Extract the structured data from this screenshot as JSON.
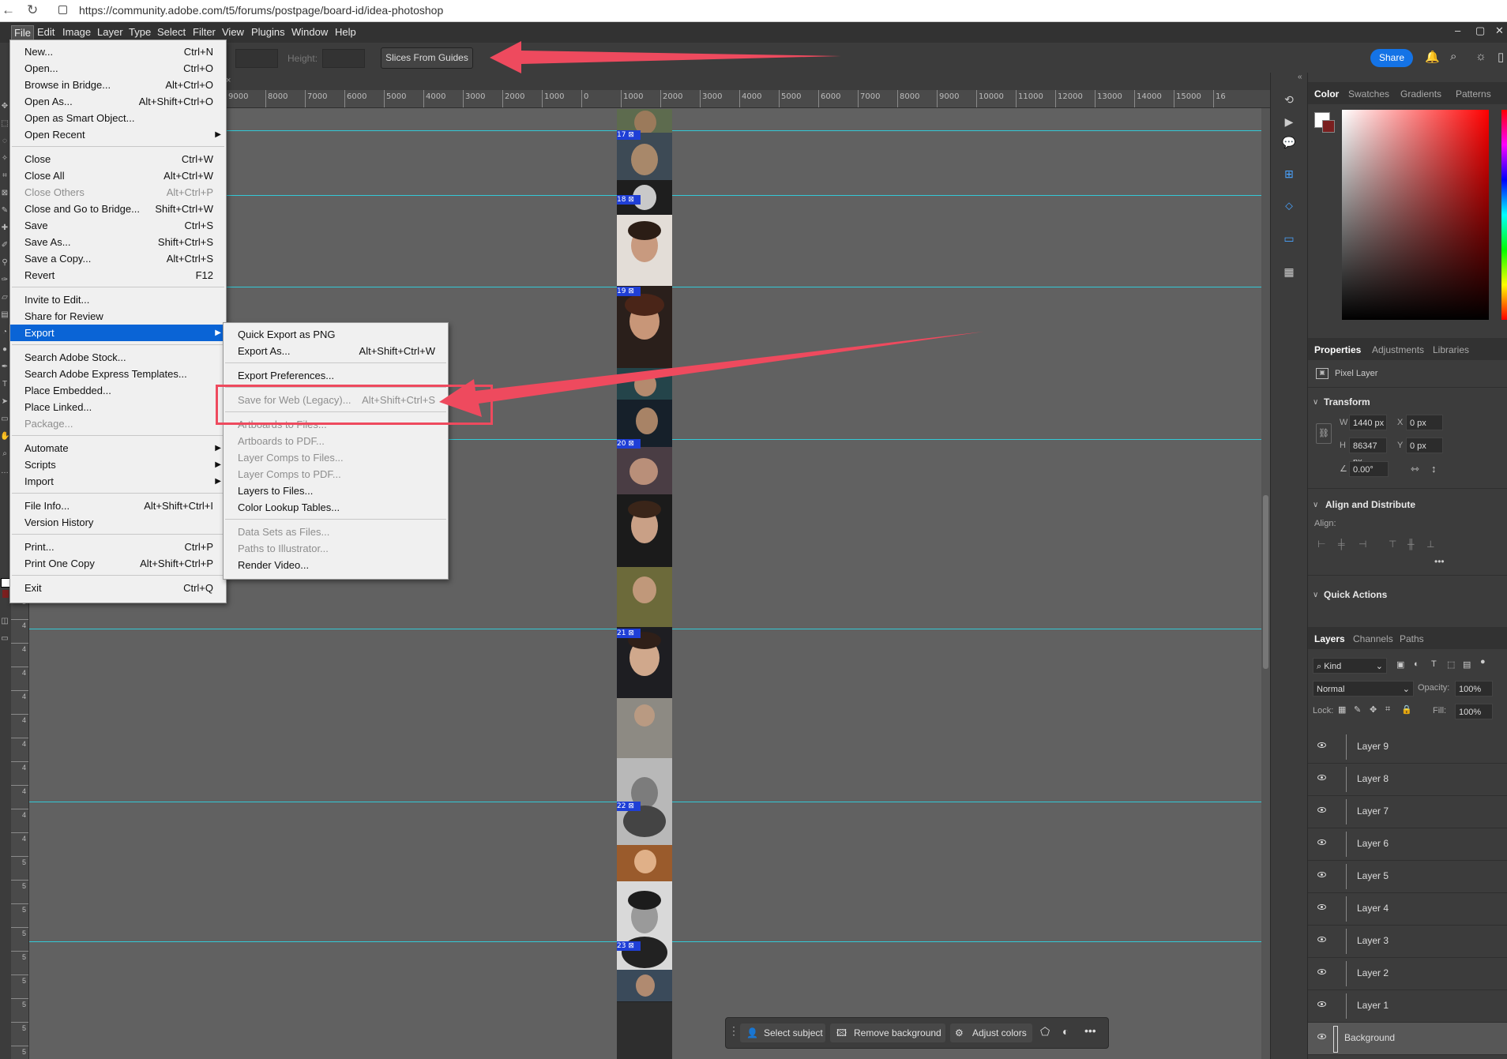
{
  "browser": {
    "url": "https://community.adobe.com/t5/forums/postpage/board-id/idea-photoshop"
  },
  "menubar": {
    "items": [
      "File",
      "Edit",
      "Image",
      "Layer",
      "Type",
      "Select",
      "Filter",
      "View",
      "Plugins",
      "Window",
      "Help"
    ]
  },
  "options": {
    "height_label": "Height:",
    "slices_button": "Slices From Guides",
    "share_button": "Share"
  },
  "ruler": {
    "h_labels": [
      "9000",
      "8000",
      "7000",
      "6000",
      "5000",
      "4000",
      "3000",
      "2000",
      "1000",
      "0",
      "1000",
      "2000",
      "3000",
      "4000",
      "5000",
      "6000",
      "7000",
      "8000",
      "9000",
      "10000",
      "11000",
      "12000",
      "13000",
      "14000",
      "15000",
      "16"
    ],
    "v_labels": [
      "3",
      "4",
      "4",
      "4",
      "4",
      "4",
      "4",
      "4",
      "4",
      "4",
      "4",
      "5",
      "5",
      "5",
      "5",
      "5",
      "5",
      "5",
      "5",
      "5",
      "5"
    ]
  },
  "slices": [
    "17",
    "18",
    "19",
    "20",
    "21",
    "22",
    "23"
  ],
  "context_bar": {
    "select_subject": "Select subject",
    "remove_background": "Remove background",
    "adjust_colors": "Adjust colors"
  },
  "color_panel": {
    "tabs": [
      "Color",
      "Swatches",
      "Gradients",
      "Patterns"
    ],
    "accent": "#ff0000"
  },
  "properties_panel": {
    "tabs": [
      "Properties",
      "Adjustments",
      "Libraries"
    ],
    "kind": "Pixel Layer",
    "transform_title": "Transform",
    "w_label": "W",
    "w_value": "1440 px",
    "h_label": "H",
    "h_value": "86347 px",
    "x_label": "X",
    "x_value": "0 px",
    "y_label": "Y",
    "y_value": "0 px",
    "angle_value": "0.00°",
    "align_title": "Align and Distribute",
    "align_label": "Align:",
    "quick_actions_title": "Quick Actions"
  },
  "layers_panel": {
    "tabs": [
      "Layers",
      "Channels",
      "Paths"
    ],
    "filter_kind": "Kind",
    "blend_mode": "Normal",
    "opacity_label": "Opacity:",
    "opacity_value": "100%",
    "lock_label": "Lock:",
    "fill_label": "Fill:",
    "fill_value": "100%",
    "layers": [
      "Layer 9",
      "Layer 8",
      "Layer 7",
      "Layer 6",
      "Layer 5",
      "Layer 4",
      "Layer 3",
      "Layer 2",
      "Layer 1",
      "Background"
    ]
  },
  "file_menu": {
    "items": [
      {
        "label": "New...",
        "shortcut": "Ctrl+N"
      },
      {
        "label": "Open...",
        "shortcut": "Ctrl+O"
      },
      {
        "label": "Browse in Bridge...",
        "shortcut": "Alt+Ctrl+O"
      },
      {
        "label": "Open As...",
        "shortcut": "Alt+Shift+Ctrl+O"
      },
      {
        "label": "Open as Smart Object...",
        "shortcut": ""
      },
      {
        "label": "Open Recent",
        "shortcut": "",
        "submenu": true
      },
      {
        "sep": true
      },
      {
        "label": "Close",
        "shortcut": "Ctrl+W"
      },
      {
        "label": "Close All",
        "shortcut": "Alt+Ctrl+W"
      },
      {
        "label": "Close Others",
        "shortcut": "Alt+Ctrl+P",
        "disabled": true
      },
      {
        "label": "Close and Go to Bridge...",
        "shortcut": "Shift+Ctrl+W"
      },
      {
        "label": "Save",
        "shortcut": "Ctrl+S"
      },
      {
        "label": "Save As...",
        "shortcut": "Shift+Ctrl+S"
      },
      {
        "label": "Save a Copy...",
        "shortcut": "Alt+Ctrl+S"
      },
      {
        "label": "Revert",
        "shortcut": "F12"
      },
      {
        "sep": true
      },
      {
        "label": "Invite to Edit...",
        "shortcut": ""
      },
      {
        "label": "Share for Review",
        "shortcut": ""
      },
      {
        "label": "Export",
        "shortcut": "",
        "submenu": true,
        "highlight": true
      },
      {
        "sep": true
      },
      {
        "label": "Search Adobe Stock...",
        "shortcut": ""
      },
      {
        "label": "Search Adobe Express Templates...",
        "shortcut": ""
      },
      {
        "label": "Place Embedded...",
        "shortcut": ""
      },
      {
        "label": "Place Linked...",
        "shortcut": ""
      },
      {
        "label": "Package...",
        "shortcut": "",
        "disabled": true
      },
      {
        "sep": true
      },
      {
        "label": "Automate",
        "shortcut": "",
        "submenu": true
      },
      {
        "label": "Scripts",
        "shortcut": "",
        "submenu": true
      },
      {
        "label": "Import",
        "shortcut": "",
        "submenu": true
      },
      {
        "sep": true
      },
      {
        "label": "File Info...",
        "shortcut": "Alt+Shift+Ctrl+I"
      },
      {
        "label": "Version History",
        "shortcut": ""
      },
      {
        "sep": true
      },
      {
        "label": "Print...",
        "shortcut": "Ctrl+P"
      },
      {
        "label": "Print One Copy",
        "shortcut": "Alt+Shift+Ctrl+P"
      },
      {
        "sep": true
      },
      {
        "label": "Exit",
        "shortcut": "Ctrl+Q"
      }
    ]
  },
  "export_menu": {
    "items": [
      {
        "label": "Quick Export as PNG",
        "shortcut": ""
      },
      {
        "label": "Export As...",
        "shortcut": "Alt+Shift+Ctrl+W"
      },
      {
        "sep": true
      },
      {
        "label": "Export Preferences...",
        "shortcut": ""
      },
      {
        "sep": true
      },
      {
        "label": "Save for Web (Legacy)...",
        "shortcut": "Alt+Shift+Ctrl+S",
        "disabled": true
      },
      {
        "sep": true
      },
      {
        "label": "Artboards to Files...",
        "shortcut": "",
        "disabled": true
      },
      {
        "label": "Artboards to PDF...",
        "shortcut": "",
        "disabled": true
      },
      {
        "label": "Layer Comps to Files...",
        "shortcut": "",
        "disabled": true
      },
      {
        "label": "Layer Comps to PDF...",
        "shortcut": "",
        "disabled": true
      },
      {
        "label": "Layers to Files...",
        "shortcut": ""
      },
      {
        "label": "Color Lookup Tables...",
        "shortcut": ""
      },
      {
        "sep": true
      },
      {
        "label": "Data Sets as Files...",
        "shortcut": "",
        "disabled": true
      },
      {
        "label": "Paths to Illustrator...",
        "shortcut": "",
        "disabled": true
      },
      {
        "label": "Render Video...",
        "shortcut": ""
      }
    ]
  },
  "annotation_color": "#ee4a5e",
  "guide_color": "#33c9d6"
}
